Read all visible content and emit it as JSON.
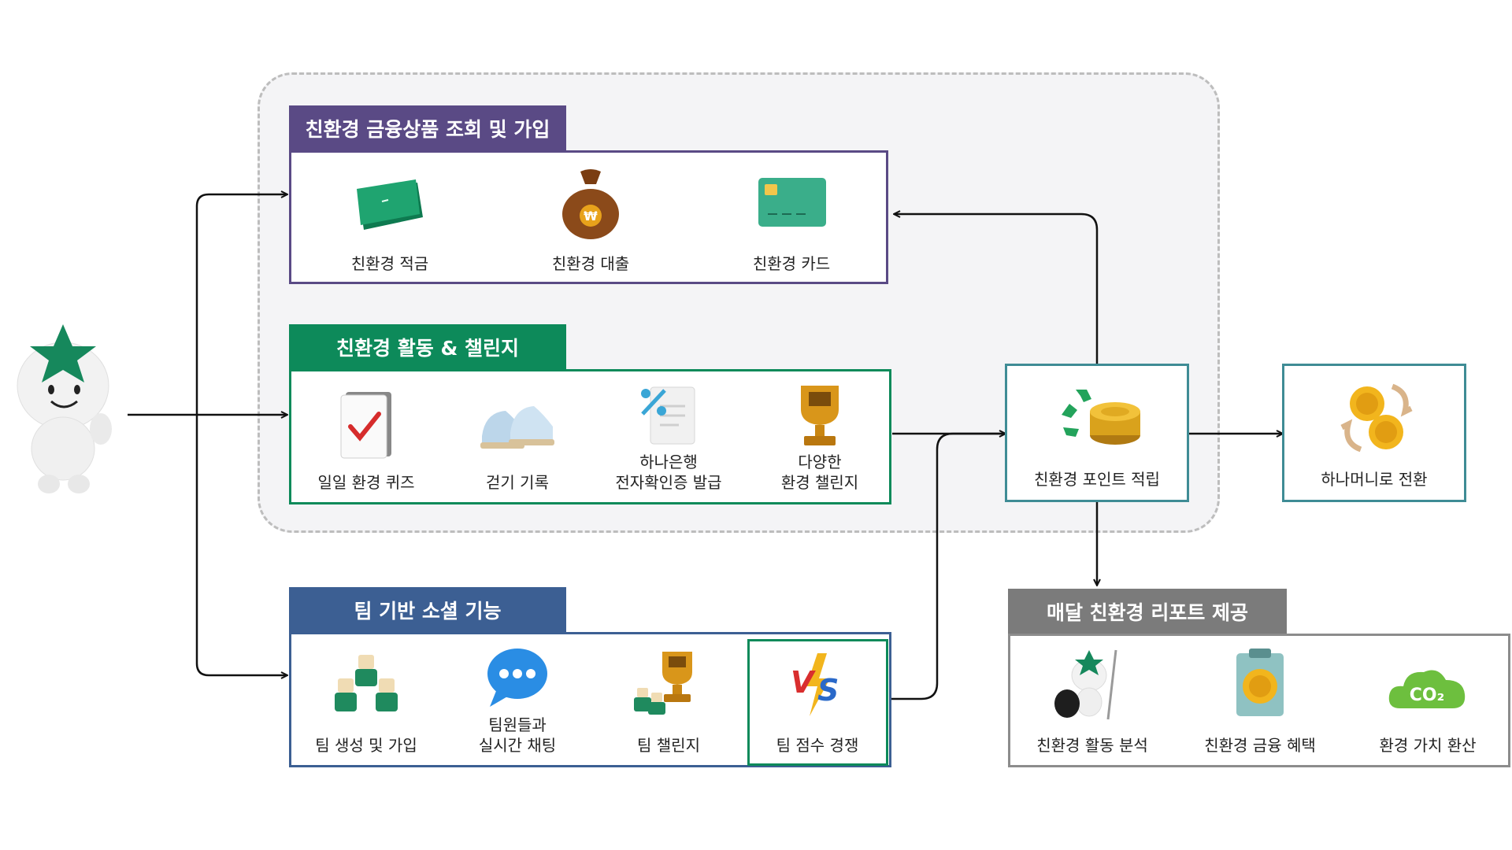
{
  "colors": {
    "purple": "#5a4a85",
    "green": "#0d8a5a",
    "blue": "#3c5f93",
    "gray": "#7b7b7b",
    "teal_box": "#3f8c95",
    "arrow": "#111111"
  },
  "mascot": {
    "icon": "star-head-mascot-icon"
  },
  "finance": {
    "title": "친환경 금융상품 조회 및 가입",
    "items": [
      {
        "label": "친환경 적금",
        "icon": "green-bankbook-icon"
      },
      {
        "label": "친환경 대출",
        "icon": "money-bag-icon"
      },
      {
        "label": "친환경 카드",
        "icon": "green-card-icon"
      }
    ]
  },
  "activity": {
    "title": "친환경 활동 & 챌린지",
    "items": [
      {
        "label": "일일 환경 퀴즈",
        "icon": "checklist-icon"
      },
      {
        "label": "걷기 기록",
        "icon": "sneakers-icon"
      },
      {
        "line1": "하나은행",
        "line2": "전자확인증 발급",
        "icon": "percent-document-icon"
      },
      {
        "line1": "다양한",
        "line2": "환경 챌린지",
        "icon": "trophy-icon"
      }
    ]
  },
  "team": {
    "title": "팀 기반 소셜 기능",
    "items": [
      {
        "label": "팀 생성 및 가입",
        "icon": "team-figures-icon"
      },
      {
        "line1": "팀원들과",
        "line2": "실시간 채팅",
        "icon": "chat-bubble-icon"
      },
      {
        "label": "팀 챌린지",
        "icon": "team-trophy-icon"
      },
      {
        "label": "팀 점수 경쟁",
        "icon": "vs-icon"
      }
    ]
  },
  "points": {
    "label": "친환경 포인트 적립",
    "icon": "recycle-coins-icon"
  },
  "hanamoney": {
    "label": "하나머니로 전환",
    "icon": "coin-exchange-icon"
  },
  "report": {
    "title": "매달 친환경 리포트 제공",
    "items": [
      {
        "label": "친환경 활동 분석",
        "icon": "mascot-cleanup-icon"
      },
      {
        "label": "친환경 금융 혜택",
        "icon": "coin-clipboard-icon"
      },
      {
        "label": "환경 가치 환산",
        "icon": "co2-cloud-icon",
        "cloud_text": "CO₂"
      }
    ]
  }
}
